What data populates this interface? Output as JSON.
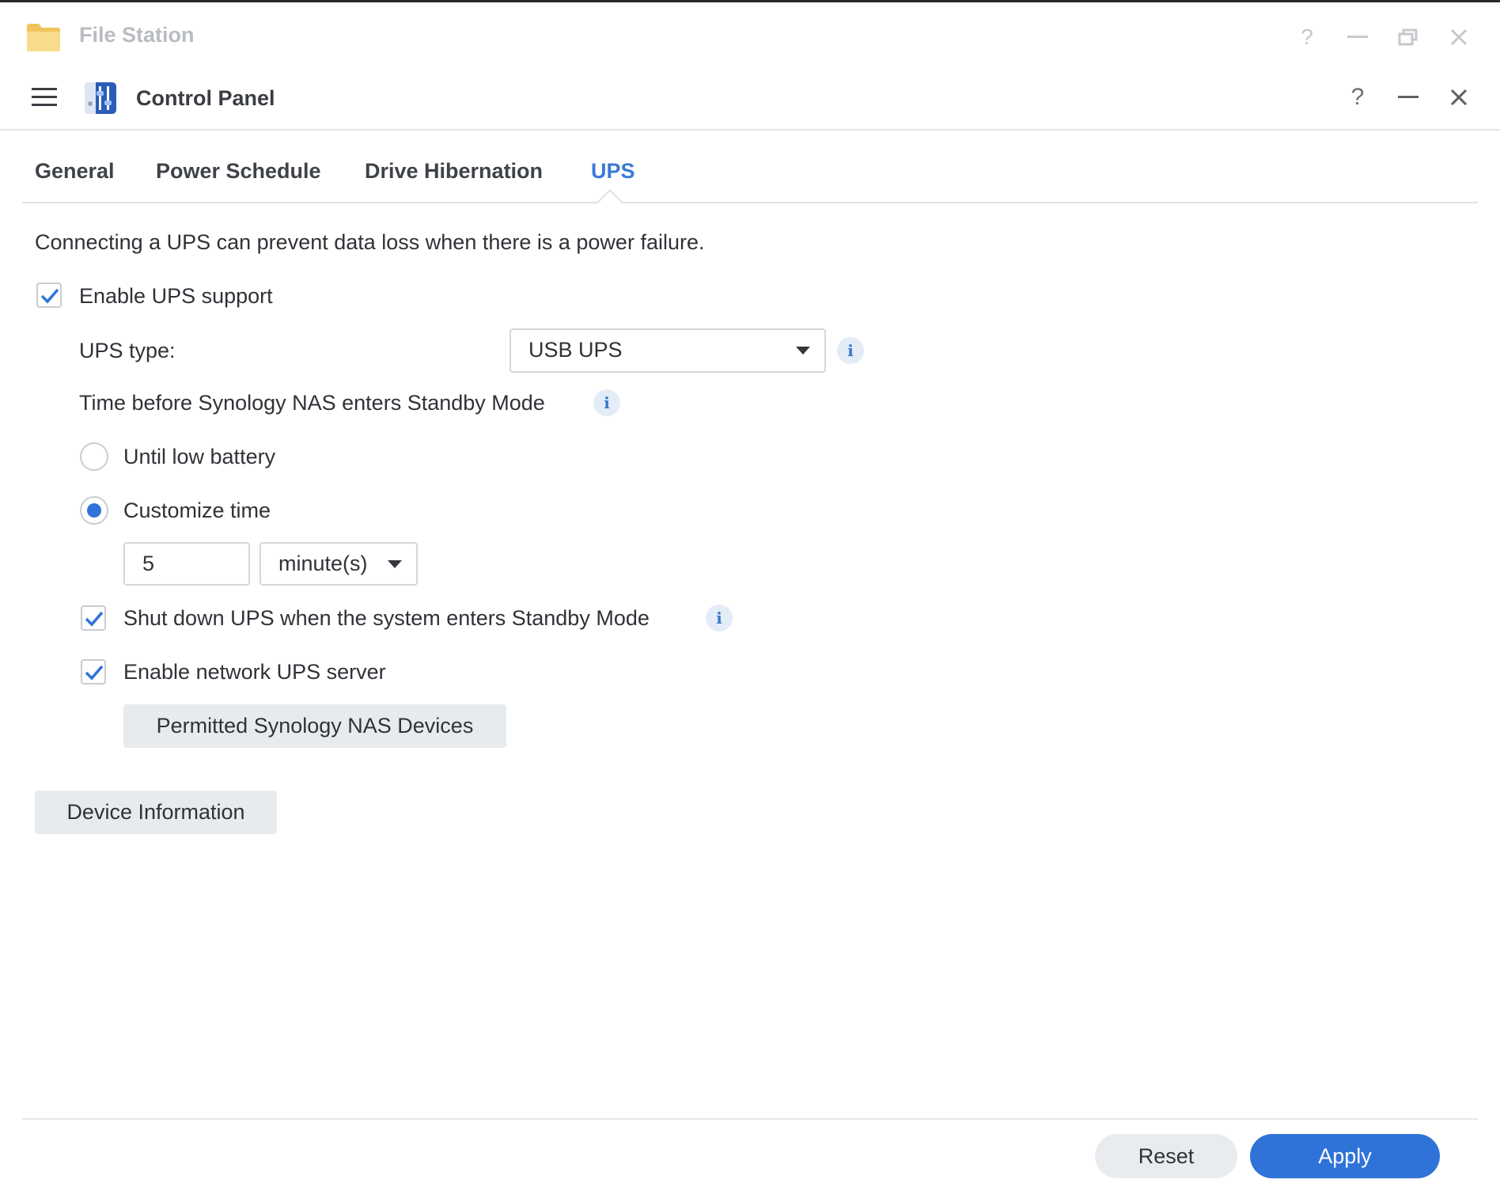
{
  "background_window": {
    "title": "File Station",
    "controls": {
      "help": "?",
      "minimize": "—",
      "restore": "restore",
      "close": "×"
    }
  },
  "window": {
    "title": "Control Panel",
    "controls": {
      "help": "?"
    }
  },
  "tabs": [
    {
      "label": "General",
      "active": false
    },
    {
      "label": "Power Schedule",
      "active": false
    },
    {
      "label": "Drive Hibernation",
      "active": false
    },
    {
      "label": "UPS",
      "active": true
    }
  ],
  "content": {
    "description": "Connecting a UPS can prevent data loss when there is a power failure.",
    "enable_ups": {
      "label": "Enable UPS support",
      "checked": true
    },
    "ups_type": {
      "label": "UPS type:",
      "value": "USB UPS"
    },
    "standby": {
      "label": "Time before Synology NAS enters Standby Mode",
      "options": [
        {
          "label": "Until low battery",
          "selected": false
        },
        {
          "label": "Customize time",
          "selected": true
        }
      ],
      "time_value": "5",
      "time_unit": "minute(s)"
    },
    "shutdown_ups": {
      "label": "Shut down UPS when the system enters Standby Mode",
      "checked": true
    },
    "network_ups": {
      "label": "Enable network UPS server",
      "checked": true
    },
    "permitted_button": "Permitted Synology NAS Devices",
    "device_info_button": "Device Information"
  },
  "footer": {
    "reset": "Reset",
    "apply": "Apply"
  },
  "colors": {
    "accent": "#2f73d8",
    "active_tab": "#3a7ad6",
    "info_bg": "#e3ecf7"
  },
  "icons": {
    "folder": "folder-icon",
    "control_panel": "control-panel-icon",
    "menu": "hamburger-menu-icon",
    "info": "info-icon",
    "checkmark": "checkmark-icon",
    "dropdown": "chevron-down-icon"
  }
}
